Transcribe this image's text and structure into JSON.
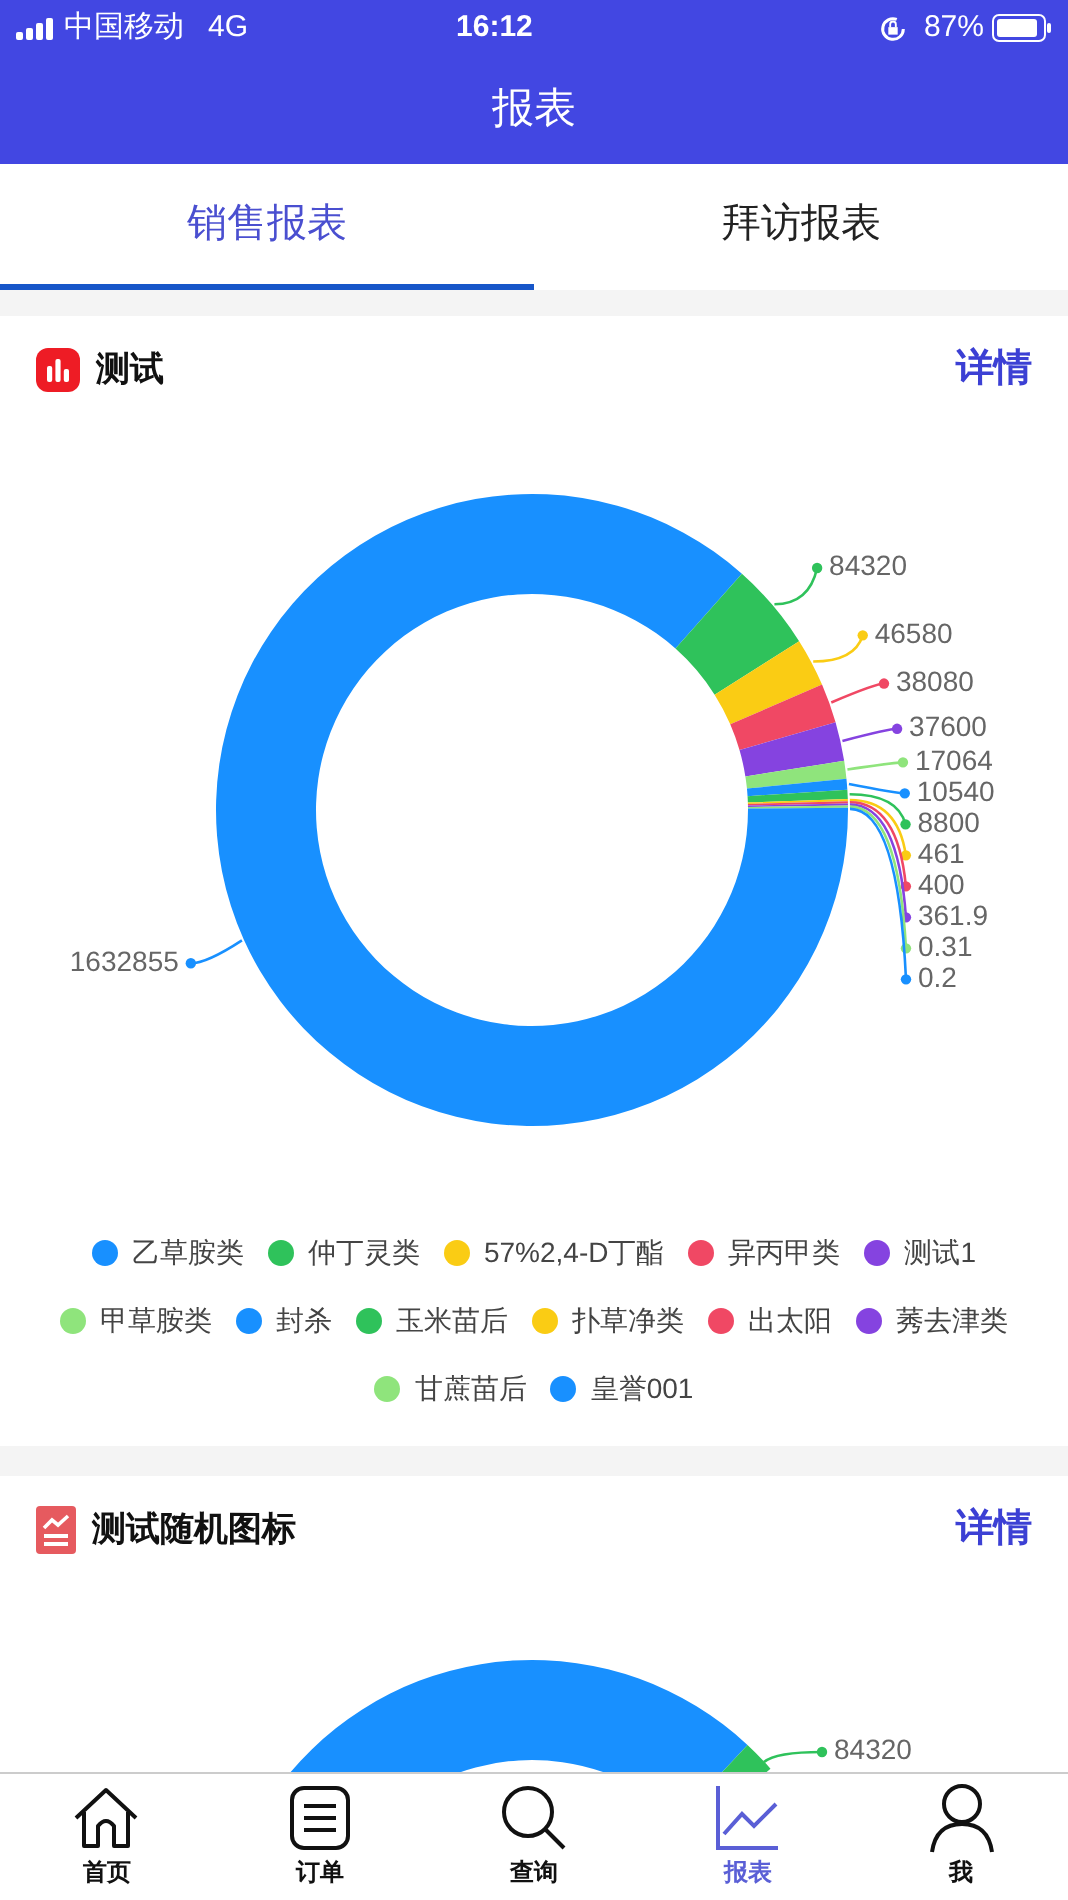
{
  "status_bar": {
    "carrier": "中国移动",
    "network": "4G",
    "time": "16:12",
    "battery": "87%"
  },
  "header": {
    "title": "报表"
  },
  "tabs": [
    {
      "label": "销售报表",
      "selected": true
    },
    {
      "label": "拜访报表",
      "selected": false
    }
  ],
  "cards": [
    {
      "title": "测试",
      "kind": "bars",
      "link": "详情",
      "chart_data": {
        "type": "donut",
        "data_labels": true,
        "categories": [
          "乙草胺类",
          "仲丁灵类",
          "57%2,4-D丁酯",
          "异丙甲类",
          "测试1",
          "甲草胺类",
          "封杀",
          "玉米苗后",
          "扑草净类",
          "出太阳",
          "莠去津类",
          "甘蔗苗后",
          "皇誉001"
        ],
        "values": [
          1632855,
          84320,
          46580,
          38080,
          37600,
          17064,
          10540,
          8800,
          461,
          400,
          361.9,
          0.31,
          0.2
        ],
        "colors": [
          "#1890ff",
          "#2fc25b",
          "#facc14",
          "#f04864",
          "#8543e0",
          "#8fe47c",
          "#1890ff",
          "#2fc25b",
          "#facc14",
          "#f04864",
          "#8543e0",
          "#8fe47c",
          "#1890ff"
        ]
      }
    },
    {
      "title": "测试随机图标",
      "kind": "trend",
      "link": "详情",
      "visible_label": "84320"
    }
  ],
  "bottom_nav": [
    {
      "label": "首页",
      "kind": "home",
      "selected": false
    },
    {
      "label": "订单",
      "kind": "list",
      "selected": false
    },
    {
      "label": "查询",
      "kind": "search",
      "selected": false
    },
    {
      "label": "报表",
      "kind": "chart",
      "selected": true
    },
    {
      "label": "我",
      "kind": "user",
      "selected": false
    }
  ]
}
